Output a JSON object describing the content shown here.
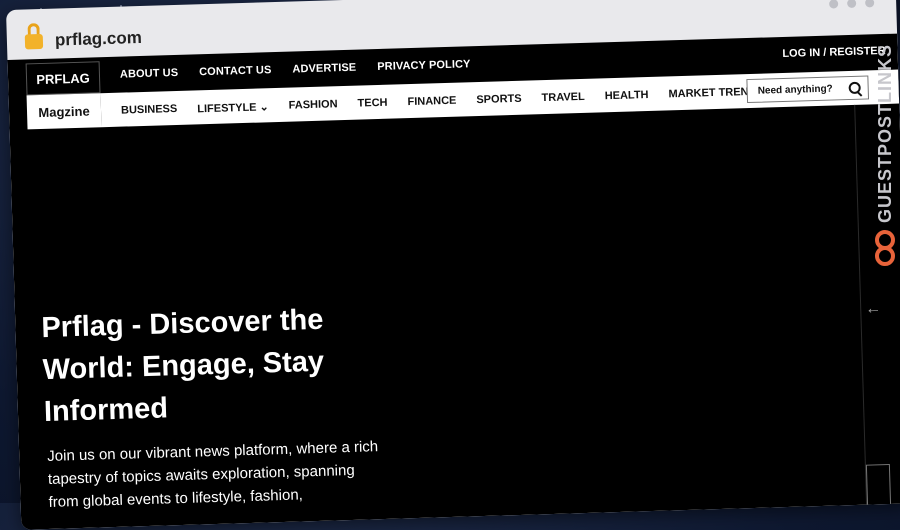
{
  "browser": {
    "url": "prflag.com"
  },
  "site": {
    "brand_top": "PRFLAG",
    "brand_bottom": "Magzine",
    "top_nav": [
      "ABOUT US",
      "CONTACT US",
      "ADVERTISE",
      "PRIVACY POLICY"
    ],
    "login": "LOG IN / REGISTER",
    "category_nav": [
      "BUSINESS",
      "LIFESTYLE",
      "FASHION",
      "TECH",
      "FINANCE",
      "SPORTS",
      "TRAVEL",
      "HEALTH",
      "MARKET TRENDS"
    ],
    "search_placeholder": "Need anything?"
  },
  "hero": {
    "title": "Prflag - Discover the World: Engage, Stay Informed",
    "description": "Join us on our vibrant news platform, where a rich tapestry of topics awaits exploration, spanning from global events to lifestyle, fashion,"
  },
  "watermark": {
    "text": "GUESTPOSTLINKS"
  },
  "icons": {
    "lock": "lock-icon",
    "search": "search-icon",
    "arrow": "arrow-left-icon",
    "lifestyle_caret": "chevron-down-icon"
  },
  "colors": {
    "background": "#0e1830",
    "page": "#000000",
    "lock": "#f2b22a",
    "watermark_logo": "#e8633a"
  }
}
